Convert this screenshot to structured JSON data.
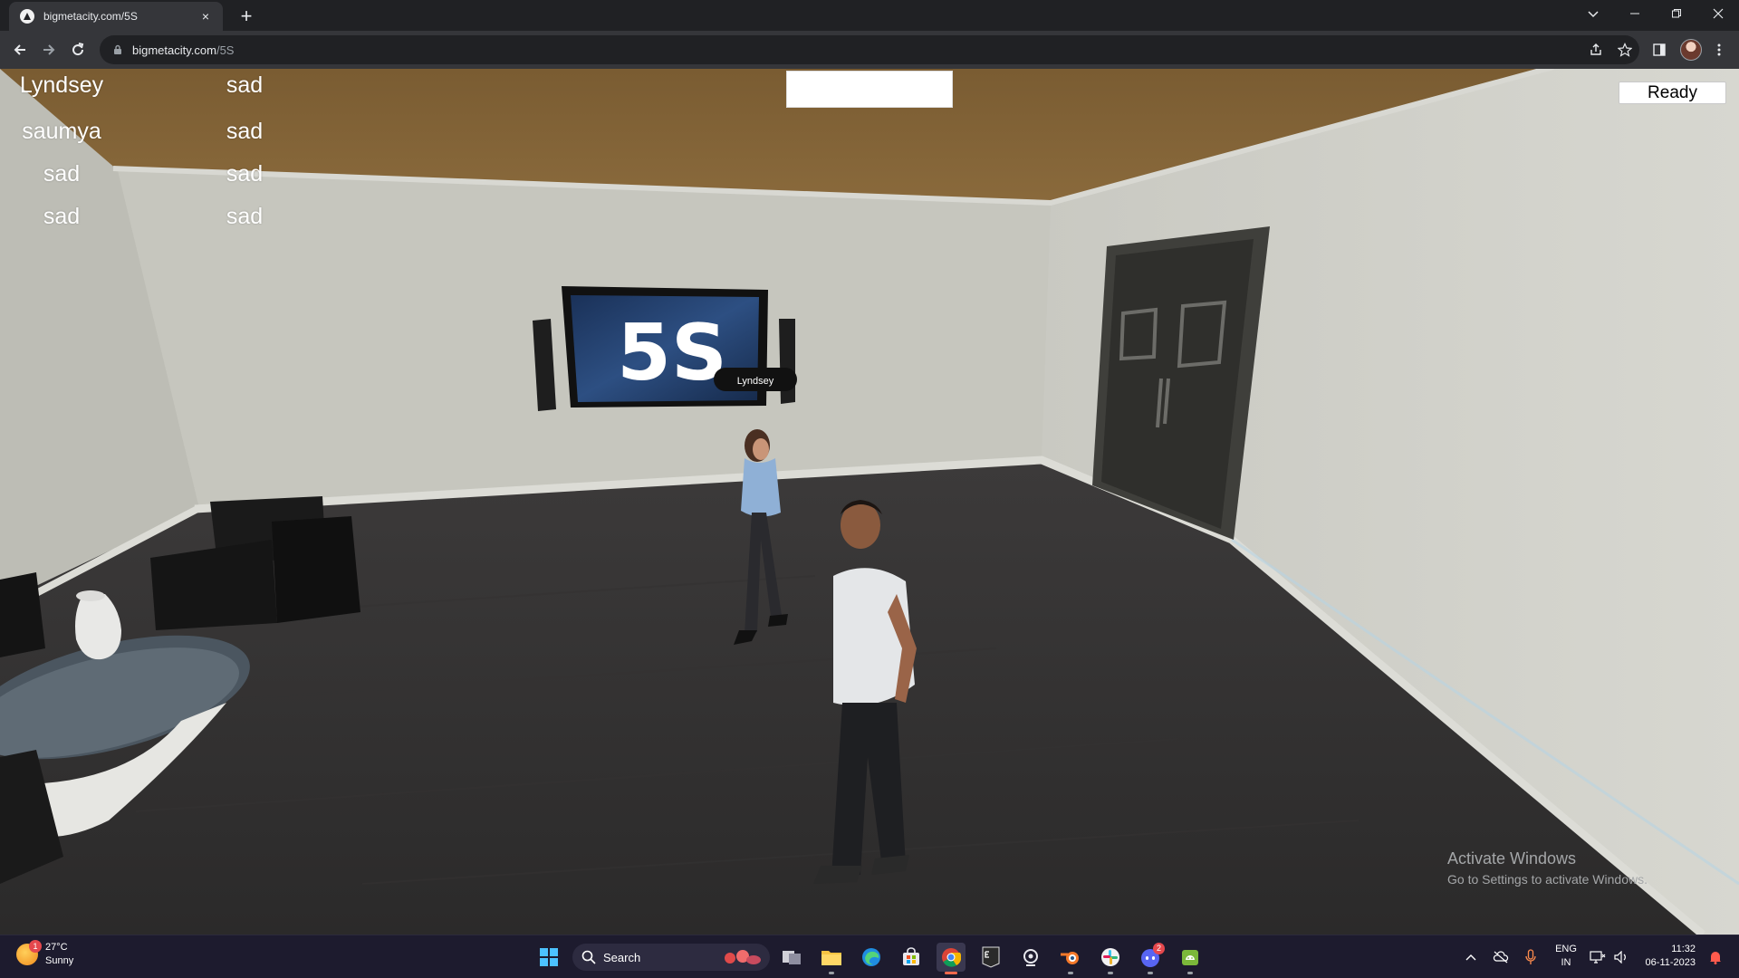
{
  "browser": {
    "tab_title": "bigmetacity.com/5S",
    "tab_close": "×",
    "new_tab": "+",
    "url_host": "bigmetacity.com",
    "url_path": "/5S"
  },
  "hud": {
    "players": [
      {
        "name": "Lyndsey",
        "status": "sad"
      },
      {
        "name": "saumya",
        "status": "sad"
      },
      {
        "name": "sad",
        "status": "sad"
      },
      {
        "name": "sad",
        "status": "sad"
      }
    ],
    "ready_label": "Ready",
    "chat_value": ""
  },
  "scene": {
    "tv_logo": "5S",
    "nametag": "Lyndsey"
  },
  "watermark": {
    "title": "Activate Windows",
    "subtitle": "Go to Settings to activate Windows."
  },
  "taskbar": {
    "weather_temp": "27°C",
    "weather_desc": "Sunny",
    "weather_badge": "1",
    "search_label": "Search",
    "discord_badge": "2",
    "lang_1": "ENG",
    "lang_2": "IN",
    "time": "11:32",
    "date": "06-11-2023"
  }
}
